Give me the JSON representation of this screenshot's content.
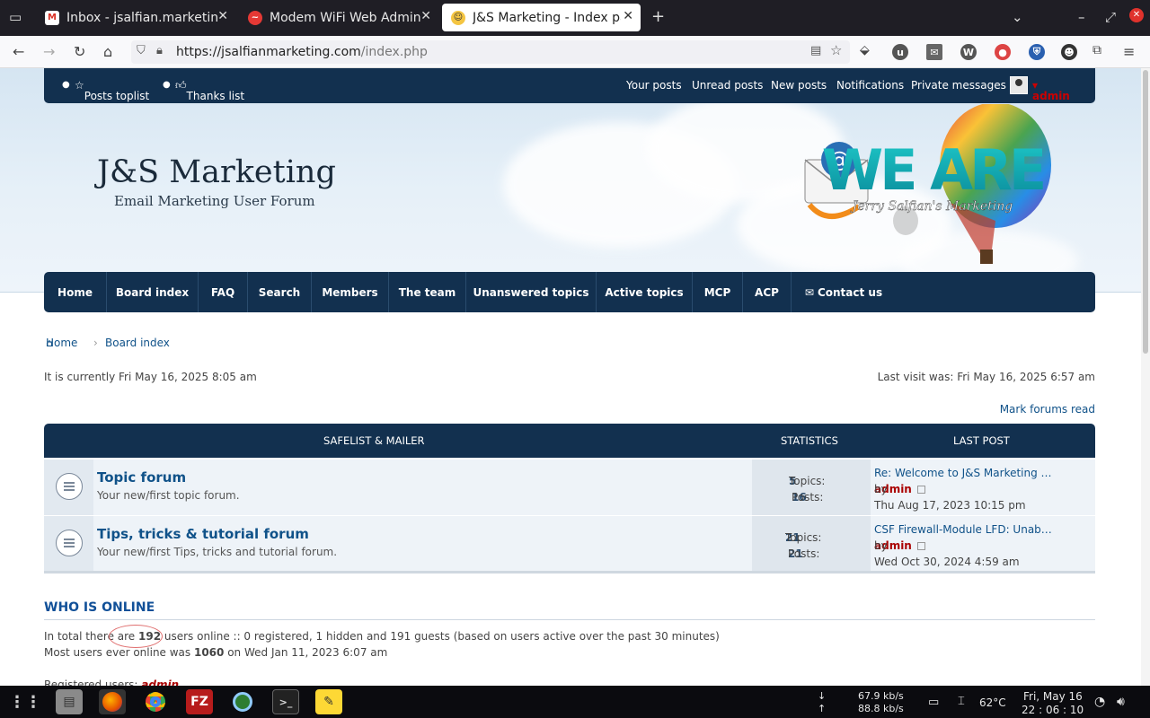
{
  "browser": {
    "tabs": [
      {
        "title": "Inbox - jsalfian.marketing@",
        "active": false,
        "favicon": "M"
      },
      {
        "title": "Modem WiFi Web Admin",
        "active": false,
        "favicon": "~"
      },
      {
        "title": "J&S Marketing - Index page",
        "active": true,
        "favicon": "☺"
      }
    ],
    "url_main": "https://jsalfianmarketing.com",
    "url_path": "/index.php"
  },
  "topbar": {
    "posts_toplist": "Posts toplist",
    "thanks_list": "Thanks list",
    "your_posts": "Your posts",
    "unread_posts": "Unread posts",
    "new_posts": "New posts",
    "notifications": "Notifications",
    "private_messages": "Private messages",
    "user": "admin"
  },
  "site": {
    "name": "J&S Marketing",
    "description": "Email Marketing User Forum",
    "logo_text": "WE ARE",
    "logo_sub": "Jerry Salfian's Marketing"
  },
  "nav": [
    "Home",
    "Board index",
    "FAQ",
    "Search",
    "Members",
    "The team",
    "Unanswered topics",
    "Active topics",
    "MCP",
    "ACP",
    "Contact us"
  ],
  "breadcrumbs": {
    "home": "Home",
    "board": "Board index"
  },
  "current_time": "It is currently Fri May 16, 2025 8:05 am",
  "last_visit": "Last visit was: Fri May 16, 2025 6:57 am",
  "mark_read": "Mark forums read",
  "table_head": {
    "category": "SAFELIST & MAILER",
    "statistics": "STATISTICS",
    "last_post": "LAST POST"
  },
  "forums": [
    {
      "title": "Topic forum",
      "desc": "Your new/first topic forum.",
      "topics_label": "Topics:",
      "topics": "5",
      "posts_label": "Posts:",
      "posts": "16",
      "last_title": "Re: Welcome to J&S Marketing …",
      "by": "by",
      "last_user": "admin",
      "last_date": "Thu Aug 17, 2023 10:15 pm"
    },
    {
      "title": "Tips, tricks & tutorial forum",
      "desc": "Your new/first Tips, tricks and tutorial forum.",
      "topics_label": "Topics:",
      "topics": "21",
      "posts_label": "Posts:",
      "posts": "21",
      "last_title": "CSF Firewall-Module LFD: Unab…",
      "by": "by",
      "last_user": "admin",
      "last_date": "Wed Oct 30, 2024 4:59 am"
    }
  ],
  "who_is_online": {
    "title": "WHO IS ONLINE",
    "line1_pre": "In total there are ",
    "line1_count": "192",
    "line1_post": " users online :: 0 registered, 1 hidden and 191 guests (based on users active over the past 30 minutes)",
    "line2_pre": "Most users ever online was ",
    "line2_count": "1060",
    "line2_post": " on Wed Jan 11, 2023 6:07 am",
    "registered_label": "Registered users: ",
    "registered_user": "admin"
  },
  "taskbar": {
    "net_down": "67.9 kb/s",
    "net_up": "88.8 kb/s",
    "temp": "62°C",
    "date": "Fri, May 16",
    "time": "22 : 06 : 10"
  }
}
